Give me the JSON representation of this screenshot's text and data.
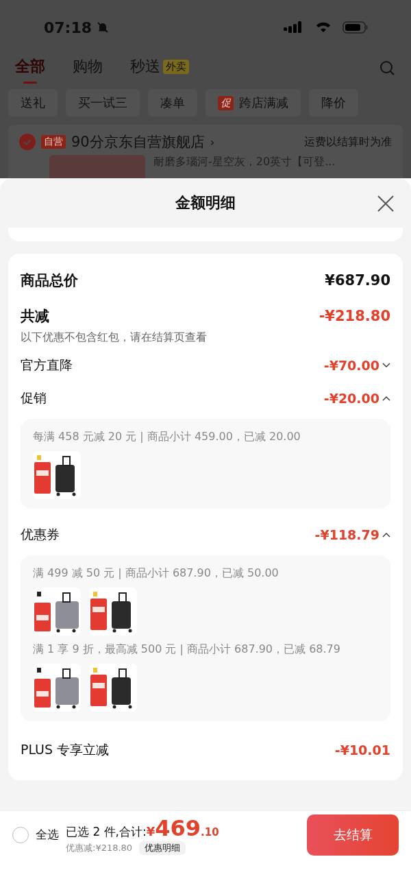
{
  "status_bar": {
    "time": "07:18"
  },
  "tabs": [
    {
      "label": "全部",
      "selected": true
    },
    {
      "label": "购物",
      "selected": false
    },
    {
      "label": "秒送",
      "selected": false,
      "badge": "外卖"
    }
  ],
  "chips": [
    {
      "label": "送礼"
    },
    {
      "label": "买一试三"
    },
    {
      "label": "凑单"
    },
    {
      "label": "跨店满减",
      "tag": "促"
    },
    {
      "label": "降价"
    }
  ],
  "store": {
    "checked": true,
    "tag": "自营",
    "name": "90分京东自营旗舰店",
    "arrow": "›",
    "note": "运费以结算时为准"
  },
  "product": {
    "title": "耐磨多瑙河-星空灰，20英寸【可登..."
  },
  "sheet": {
    "title": "金额明细",
    "total": {
      "label": "商品总价",
      "value": "¥687.90"
    },
    "reduction": {
      "label": "共减",
      "value": "-¥218.80",
      "note": "以下优惠不包含红包，请在结算页查看"
    },
    "rows": [
      {
        "kind": "collapsible",
        "label": "官方直降",
        "value": "-¥70.00",
        "expanded": false
      },
      {
        "kind": "collapsible",
        "label": "促销",
        "value": "-¥20.00",
        "expanded": true,
        "groups": [
          {
            "text": "每满 458 元减 20 元 | 商品小计 459.00，已减 20.00"
          }
        ]
      },
      {
        "kind": "collapsible",
        "label": "优惠券",
        "value": "-¥118.79",
        "expanded": true,
        "groups": [
          {
            "text": "满 499 减 50 元 | 商品小计 687.90，已减 50.00"
          },
          {
            "text": "满 1 享 9 折，最高减 500 元 | 商品小计 687.90，已减 68.79"
          }
        ]
      },
      {
        "kind": "plain",
        "label": "PLUS 专享立减",
        "value": "-¥10.01"
      }
    ]
  },
  "bottom_bar": {
    "select_all": {
      "label": "全选",
      "checked": false
    },
    "summary": "已选 2 件,合计:",
    "currency": "¥",
    "price_int": "469",
    "price_dec": ".10",
    "discount": "优惠减:¥218.80",
    "detail_button": "优惠明细",
    "checkout": "去结算"
  }
}
